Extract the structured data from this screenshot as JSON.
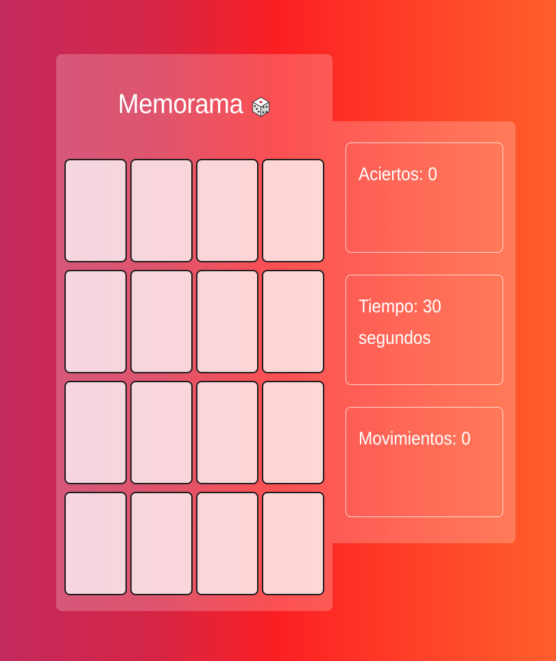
{
  "game": {
    "title": "Memorama",
    "title_icon": "dice-icon",
    "cards": [
      {
        "state": "face-down"
      },
      {
        "state": "face-down"
      },
      {
        "state": "face-down"
      },
      {
        "state": "face-down"
      },
      {
        "state": "face-down"
      },
      {
        "state": "face-down"
      },
      {
        "state": "face-down"
      },
      {
        "state": "face-down"
      },
      {
        "state": "face-down"
      },
      {
        "state": "face-down"
      },
      {
        "state": "face-down"
      },
      {
        "state": "face-down"
      },
      {
        "state": "face-down"
      },
      {
        "state": "face-down"
      },
      {
        "state": "face-down"
      },
      {
        "state": "face-down"
      }
    ]
  },
  "stats": {
    "hits": "Aciertos: 0",
    "time": "Tiempo: 30 segundos",
    "moves": "Movimientos: 0"
  },
  "colors": {
    "background_left": "#c32a5e",
    "background_mid": "#fb1f22",
    "background_right": "#ff5f2c",
    "card_face": "#f8cfd2",
    "card_border": "#1c1c1c"
  }
}
